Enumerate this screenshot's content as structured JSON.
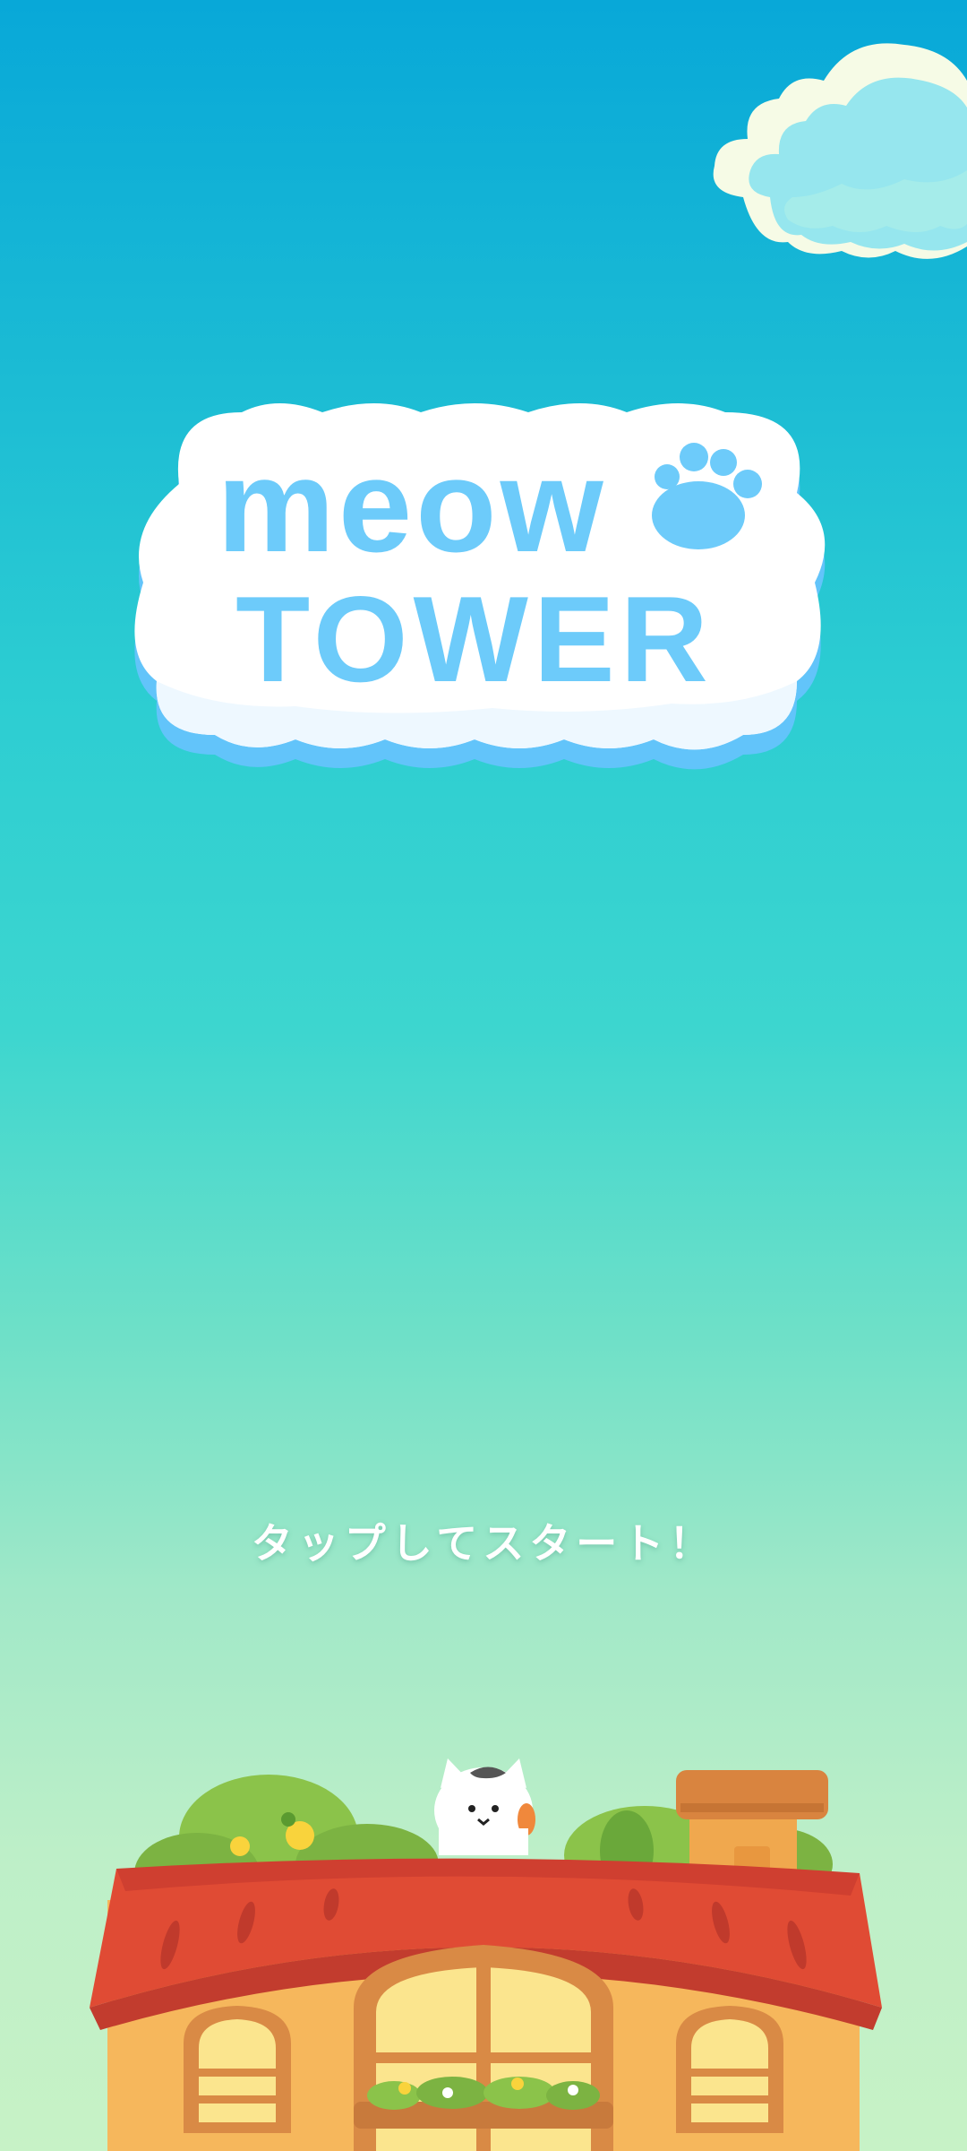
{
  "game": {
    "title_line1": "meow",
    "title_line2": "TOWER",
    "tap_prompt": "タップしてスタート！"
  },
  "colors": {
    "sky_top": "#08a8d8",
    "sky_bottom": "#c7f2c6",
    "title_letters": "#6dcbfa",
    "cloud": "#ffffff",
    "roof": "#de4a34",
    "house_wall": "#f6b75c"
  },
  "icons": {
    "paw": "paw-icon",
    "cat": "cat-icon"
  }
}
